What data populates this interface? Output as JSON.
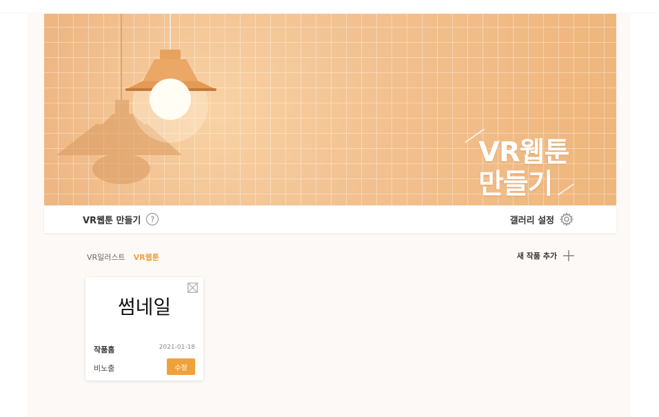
{
  "banner": {
    "title_line1": "VR웹툰",
    "title_line2": "만들기"
  },
  "toolbar": {
    "title": "VR웹툰 만들기",
    "help_icon_glyph": "?",
    "gallery_settings_label": "갤러리 설정"
  },
  "tabs": [
    {
      "label": "VR일러스트",
      "active": false
    },
    {
      "label": "VR웹툰",
      "active": true
    }
  ],
  "add_work_label": "새 작품 추가",
  "card": {
    "thumbnail_text": "썸네일",
    "title": "작품홈",
    "date": "2021-01-18",
    "visibility": "비노출",
    "edit_label": "수정"
  },
  "colors": {
    "accent": "#f0a23a",
    "banner": "#f0bb84",
    "panel_background": "#fdf9f6"
  },
  "icons": {
    "help": "question-circle-icon",
    "settings": "gear-icon",
    "add": "plus-icon",
    "close": "close-box-icon"
  }
}
